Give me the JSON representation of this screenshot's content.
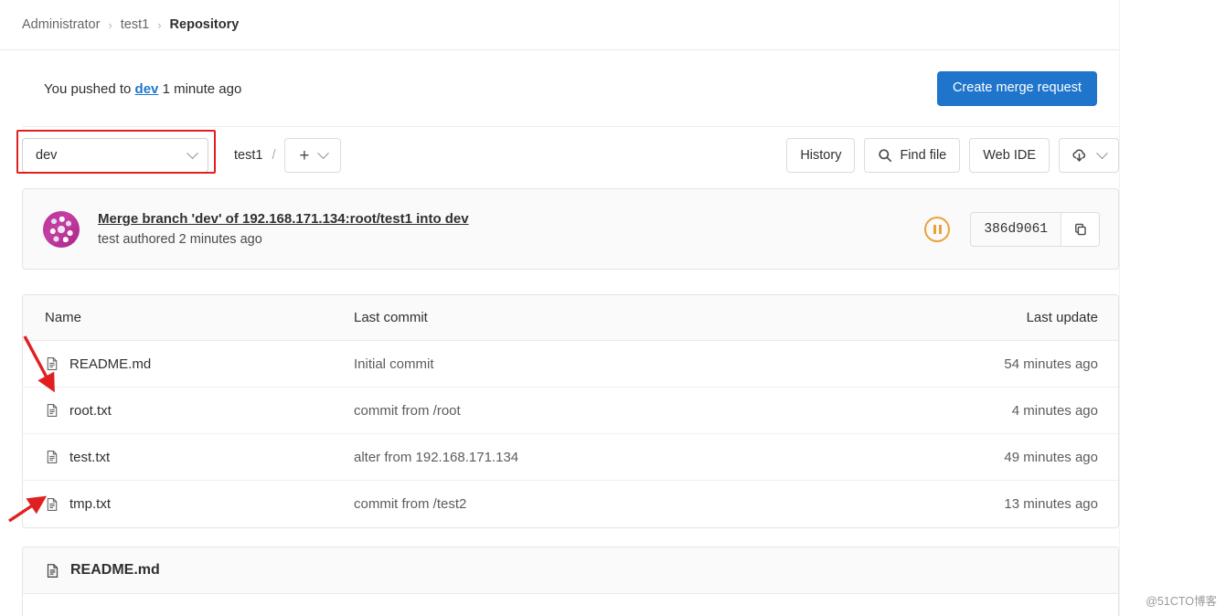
{
  "breadcrumb": {
    "items": [
      {
        "label": "Administrator",
        "current": false
      },
      {
        "label": "test1",
        "current": false
      },
      {
        "label": "Repository",
        "current": true
      }
    ],
    "separator": "›"
  },
  "push_notice": {
    "prefix": "You pushed to",
    "branch": "dev",
    "suffix": "1 minute ago",
    "create_mr_label": "Create merge request",
    "primary_color": "#1f75cb"
  },
  "toolbar": {
    "branch_selector": {
      "value": "dev",
      "icon": "chevron-down-icon",
      "annotated": true,
      "annotation_color": "#e02020"
    },
    "project_path": "test1",
    "path_separator": "/",
    "add_button": {
      "glyph": "+",
      "icon": "chevron-down-icon"
    },
    "history_label": "History",
    "find_file_label": "Find file",
    "find_file_icon": "search-icon",
    "web_ide_label": "Web IDE",
    "clone_icon": "download-cloud-icon",
    "clone_chevron": "chevron-down-icon"
  },
  "commit": {
    "avatar": "user-identicon-avatar",
    "title": "Merge branch 'dev' of 192.168.171.134:root/test1 into dev",
    "author_line": "test authored 2 minutes ago",
    "pipeline_status": "pending",
    "pipeline_color": "#e9a13b",
    "sha": "386d9061",
    "copy_icon": "copy-icon"
  },
  "file_table": {
    "columns": [
      "Name",
      "Last commit",
      "Last update"
    ],
    "rows": [
      {
        "name": "README.md",
        "icon": "file-icon",
        "commit": "Initial commit",
        "update": "54 minutes ago"
      },
      {
        "name": "root.txt",
        "icon": "file-icon",
        "commit": "commit from /root",
        "update": "4 minutes ago"
      },
      {
        "name": "test.txt",
        "icon": "file-icon",
        "commit": "alter from 192.168.171.134",
        "update": "49 minutes ago"
      },
      {
        "name": "tmp.txt",
        "icon": "file-icon",
        "commit": "commit from /test2",
        "update": "13 minutes ago"
      }
    ]
  },
  "readme": {
    "title": "README.md",
    "icon": "file-icon"
  },
  "watermark": "@51CTO博客"
}
